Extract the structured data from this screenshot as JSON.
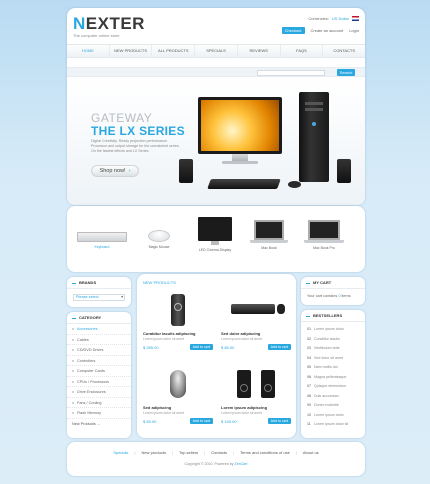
{
  "brand": {
    "first_letter": "N",
    "rest": "EXTER",
    "tagline": "The computer online store"
  },
  "header": {
    "currencies_label": "Currencies:",
    "currency_value": "US Dollar",
    "checkout": "Checkout",
    "create_account": "Create an account",
    "login": "Login"
  },
  "nav": [
    "Home",
    "New Products",
    "All Products",
    "Specials",
    "Reviews",
    "FAQs",
    "Contacts"
  ],
  "search": {
    "button": "Search"
  },
  "banner": {
    "line1": "GATEWAY",
    "line2": "THE LX SERIES",
    "text": "Digital Creativity. Ready projection performance. Processor and output storage for the unmatched series. On the fastest effects and LX Series.",
    "button": "Shop now!"
  },
  "categories": [
    {
      "label": "Keyboard"
    },
    {
      "label": "Magic Mouse"
    },
    {
      "label": "LED Cinema Display"
    },
    {
      "label": "Mac Book"
    },
    {
      "label": "Mac Book Pro"
    }
  ],
  "brands_box": {
    "title": "Brands",
    "select_value": "Please select"
  },
  "category_box": {
    "title": "Category",
    "items": [
      "Accessories",
      "Cables",
      "CD/DVD Drives",
      "Controllers",
      "Computer Cards",
      "CPUs / Processors",
      "Drive Enclosures",
      "Fans / Cooling",
      "Flash Memory"
    ],
    "more": "New Products ..."
  },
  "new_products": {
    "title": "New Products",
    "items": [
      {
        "name": "Curabitur iaculis adipiscing",
        "desc": "Lorem ipsum dolor sit amet",
        "price": "$ 285.00",
        "button": "Add to cart"
      },
      {
        "name": "Sed dolor adipiscing",
        "desc": "Lorem ipsum dolor sit amet",
        "price": "$ 85.00",
        "button": "Add to cart"
      },
      {
        "name": "Sed adipiscing",
        "desc": "Lorem ipsum dolor sit amet",
        "price": "$ 65.00",
        "button": "Add to cart"
      },
      {
        "name": "Lorem ipsum adipiscing",
        "desc": "Lorem ipsum dolor sit amet",
        "price": "$ 190.00",
        "button": "Add to cart"
      }
    ]
  },
  "cart": {
    "title": "My Cart",
    "text_before": "Your cart contains",
    "count": "0",
    "text_after": "items"
  },
  "bestsellers": {
    "title": "Bestsellers",
    "items": [
      {
        "n": "01",
        "label": "Lorem ipsum dolor"
      },
      {
        "n": "02",
        "label": "Curabitur iaculis"
      },
      {
        "n": "03",
        "label": "Vestibulum ante"
      },
      {
        "n": "04",
        "label": "Sed dolor sit amet"
      },
      {
        "n": "05",
        "label": "Nam mollis dui"
      },
      {
        "n": "06",
        "label": "Magna pellentesque"
      },
      {
        "n": "07",
        "label": "Quisque elementum"
      },
      {
        "n": "08",
        "label": "Duis accumsan"
      },
      {
        "n": "09",
        "label": "Donec molestie"
      },
      {
        "n": "10",
        "label": "Lorem ipsum dolor"
      },
      {
        "n": "11",
        "label": "Lorem ipsum dolor sit"
      }
    ]
  },
  "footer": {
    "links": [
      "Specials",
      "New products",
      "Top sellers",
      "Contacts",
      "Terms and conditions of use",
      "About us"
    ],
    "copyright": "Copyright © 2010. Powered by",
    "powered": "ZenCart"
  },
  "colors": {
    "accent": "#29a8e0",
    "background": "#d7ebf8"
  }
}
